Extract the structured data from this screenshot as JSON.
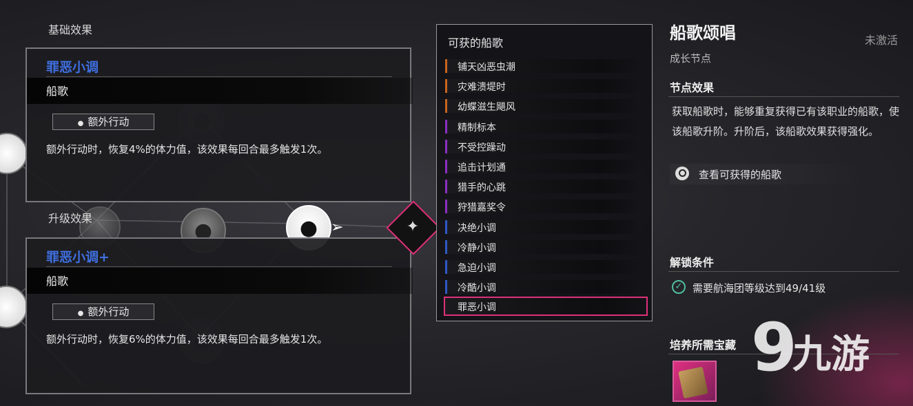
{
  "left": {
    "base_title": "基础效果",
    "upgrade_title": "升级效果",
    "base": {
      "name": "罪恶小调",
      "type": "船歌",
      "tag": "额外行动",
      "desc": "额外行动时，恢复4%的体力值，该效果每回合最多触发1次。"
    },
    "upgrade": {
      "name": "罪恶小调+",
      "type": "船歌",
      "tag": "额外行动",
      "desc": "额外行动时，恢复6%的体力值，该效果每回合最多触发1次。"
    }
  },
  "songs": {
    "title": "可获的船歌",
    "items": [
      {
        "label": "铺天凶恶虫潮",
        "color": "#c8641e"
      },
      {
        "label": "灾难溃堤时",
        "color": "#c8641e"
      },
      {
        "label": "幼蝶滋生飓风",
        "color": "#c8641e"
      },
      {
        "label": "精制标本",
        "color": "#8a2fc0"
      },
      {
        "label": "不受控躁动",
        "color": "#8a2fc0"
      },
      {
        "label": "追击计划通",
        "color": "#8a2fc0"
      },
      {
        "label": "猎手的心跳",
        "color": "#8a2fc0"
      },
      {
        "label": "狩猎嘉奖令",
        "color": "#8a2fc0"
      },
      {
        "label": "决绝小调",
        "color": "#2f58c8"
      },
      {
        "label": "冷静小调",
        "color": "#2f58c8"
      },
      {
        "label": "急迫小调",
        "color": "#2f58c8"
      },
      {
        "label": "冷酷小调",
        "color": "#2f58c8"
      },
      {
        "label": "罪恶小调",
        "color": "#e0307a",
        "selected": true
      }
    ]
  },
  "right": {
    "title": "船歌颂唱",
    "status": "未激活",
    "subtitle": "成长节点",
    "node_effect_title": "节点效果",
    "node_effect_desc": "获取船歌时，能够重复获得已有该职业的船歌，使该船歌升阶。升阶后，该船歌效果获得强化。",
    "view_songs_label": "查看可获得的船歌",
    "unlock_title": "解锁条件",
    "unlock_text": "需要航海团等级达到49/41级",
    "treasure_title": "培养所需宝藏"
  },
  "watermark": {
    "logo": "9",
    "text": "九游"
  },
  "colors": {
    "accent": "#e0307a",
    "name_blue": "#3f6fe0",
    "check": "#4fbfa0"
  }
}
